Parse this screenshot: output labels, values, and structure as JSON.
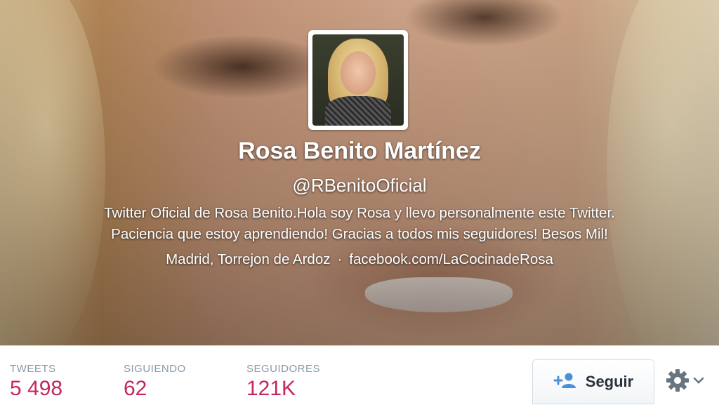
{
  "profile": {
    "name": "Rosa Benito Martínez",
    "handle": "@RBenitoOficial",
    "bio_line1": "Twitter Oficial de Rosa Benito.Hola soy Rosa y llevo personalmente este Twitter.",
    "bio_line2": "Paciencia que estoy aprendiendo! Gracias a todos mis seguidores! Besos Mil!",
    "location": "Madrid, Torrejon de Ardoz",
    "separator": "·",
    "website": "facebook.com/LaCocinadeRosa"
  },
  "stats": [
    {
      "label": "TWEETS",
      "value": "5 498"
    },
    {
      "label": "SIGUIENDO",
      "value": "62"
    },
    {
      "label": "SEGUIDORES",
      "value": "121K"
    }
  ],
  "actions": {
    "follow_label": "Seguir",
    "follow_icon": "add-user-icon",
    "settings_icon": "gear-icon"
  },
  "colors": {
    "stat_value": "#c5265f",
    "stat_label": "#8899a6",
    "follow_icon": "#4a90d9"
  }
}
